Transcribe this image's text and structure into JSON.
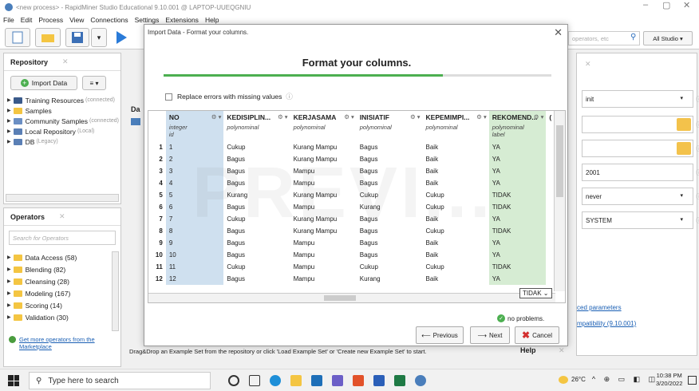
{
  "window": {
    "title": "<new process> - RapidMiner Studio Educational 9.10.001 @ LAPTOP-UUEQGNIU",
    "minimize": "–",
    "maximize": "▢",
    "close": "✕"
  },
  "menu": [
    "File",
    "Edit",
    "Process",
    "View",
    "Connections",
    "Settings",
    "Extensions",
    "Help"
  ],
  "toolbar": {
    "search_placeholder": "operators, etc",
    "studio_label": "All Studio ▾"
  },
  "repository": {
    "title": "Repository",
    "close": "✕",
    "import_label": "Import Data",
    "menu_label": "≡ ▾",
    "items": [
      {
        "label": "Training Resources",
        "note": "(connected)"
      },
      {
        "label": "Samples",
        "note": ""
      },
      {
        "label": "Community Samples",
        "note": "(connected)"
      },
      {
        "label": "Local Repository",
        "note": "(Local)"
      },
      {
        "label": "DB",
        "note": "(Legacy)"
      }
    ]
  },
  "operators": {
    "title": "Operators",
    "close": "✕",
    "search_placeholder": "Search for Operators",
    "items": [
      "Data Access (58)",
      "Blending (82)",
      "Cleansing (28)",
      "Modeling (167)",
      "Scoring (14)",
      "Validation (30)"
    ],
    "more_link": "Get more operators from the Marketplace"
  },
  "center_tab": "Da",
  "status_text": "Drag&Drop an Example Set from the repository or click 'Load Example Set' or 'Create new Example Set' to start.",
  "help_tab": "Help",
  "help_close": "✕",
  "right_panel": {
    "close": "✕",
    "fields": [
      "init",
      "",
      "",
      "2001",
      "never",
      "SYSTEM"
    ],
    "link1": "ced parameters",
    "link2": "mpatibility (9.10.001)"
  },
  "dialog": {
    "title": "Import Data - Format your columns.",
    "close": "✕",
    "heading": "Format your columns.",
    "progress": 0.72,
    "replace_label": "Replace errors with missing values",
    "info_icon": "ⓘ",
    "columns": [
      {
        "name": "NO",
        "type": "integer",
        "role": "id"
      },
      {
        "name": "KEDISIPLIN...",
        "type": "polynominal",
        "role": ""
      },
      {
        "name": "KERJASAMA",
        "type": "polynominal",
        "role": ""
      },
      {
        "name": "INISIATIF",
        "type": "polynominal",
        "role": ""
      },
      {
        "name": "KEPEMIMPI...",
        "type": "polynominal",
        "role": ""
      },
      {
        "name": "REKOMEND...",
        "type": "polynominal",
        "role": "label"
      },
      {
        "name": "(",
        "type": "",
        "role": ""
      }
    ],
    "rows": [
      [
        "1",
        "1",
        "Cukup",
        "Kurang Mampu",
        "Bagus",
        "Baik",
        "YA"
      ],
      [
        "2",
        "2",
        "Bagus",
        "Kurang Mampu",
        "Bagus",
        "Baik",
        "YA"
      ],
      [
        "3",
        "3",
        "Bagus",
        "Mampu",
        "Bagus",
        "Baik",
        "YA"
      ],
      [
        "4",
        "4",
        "Bagus",
        "Mampu",
        "Bagus",
        "Baik",
        "YA"
      ],
      [
        "5",
        "5",
        "Kurang",
        "Kurang Mampu",
        "Cukup",
        "Cukup",
        "TIDAK"
      ],
      [
        "6",
        "6",
        "Bagus",
        "Mampu",
        "Kurang",
        "Cukup",
        "TIDAK"
      ],
      [
        "7",
        "7",
        "Cukup",
        "Kurang Mampu",
        "Bagus",
        "Baik",
        "YA"
      ],
      [
        "8",
        "8",
        "Bagus",
        "Kurang Mampu",
        "Bagus",
        "Cukup",
        "TIDAK"
      ],
      [
        "9",
        "9",
        "Bagus",
        "Mampu",
        "Bagus",
        "Baik",
        "YA"
      ],
      [
        "10",
        "10",
        "Bagus",
        "Mampu",
        "Bagus",
        "Baik",
        "YA"
      ],
      [
        "11",
        "11",
        "Cukup",
        "Mampu",
        "Cukup",
        "Cukup",
        "TIDAK"
      ],
      [
        "12",
        "12",
        "Bagus",
        "Mampu",
        "Kurang",
        "Baik",
        "YA"
      ]
    ],
    "tidak_cell": "TIDAK",
    "no_problems": "no problems.",
    "prev_label": "Previous",
    "next_label": "Next",
    "cancel_label": "Cancel"
  },
  "watermark": "PREVI...",
  "taskbar": {
    "search_placeholder": "Type here to search",
    "weather": "26°C",
    "time": "10:38 PM",
    "date": "3/20/2022"
  },
  "colors": {
    "id_column": "#cfe0ef",
    "label_column": "#d6ecd3",
    "progress": "#4caf50"
  }
}
